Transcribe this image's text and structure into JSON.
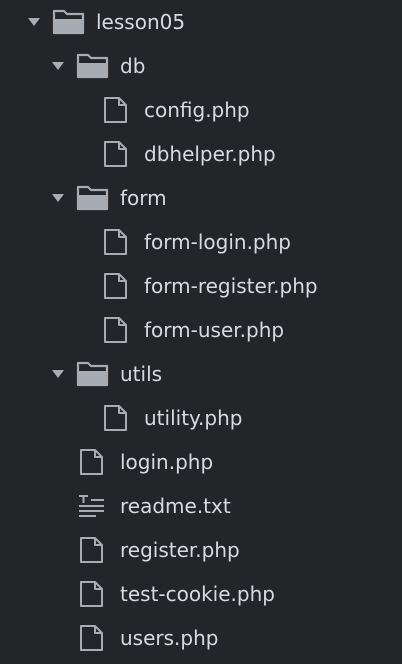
{
  "colors": {
    "background": "#232529",
    "text": "#d7dae0",
    "icon": "#a7abb2",
    "folder_fill": "#a7abb2"
  },
  "tree": {
    "root": {
      "label": "lesson05",
      "icon": "folder-open-icon",
      "expanded": true
    },
    "db": {
      "label": "db",
      "icon": "folder-open-icon",
      "expanded": true,
      "files": [
        {
          "label": "config.php",
          "icon": "file-icon"
        },
        {
          "label": "dbhelper.php",
          "icon": "file-icon"
        }
      ]
    },
    "form": {
      "label": "form",
      "icon": "folder-open-icon",
      "expanded": true,
      "files": [
        {
          "label": "form-login.php",
          "icon": "file-icon"
        },
        {
          "label": "form-register.php",
          "icon": "file-icon"
        },
        {
          "label": "form-user.php",
          "icon": "file-icon"
        }
      ]
    },
    "utils": {
      "label": "utils",
      "icon": "folder-open-icon",
      "expanded": true,
      "files": [
        {
          "label": "utility.php",
          "icon": "file-icon"
        }
      ]
    },
    "root_files": [
      {
        "label": "login.php",
        "icon": "file-icon"
      },
      {
        "label": "readme.txt",
        "icon": "text-file-icon"
      },
      {
        "label": "register.php",
        "icon": "file-icon"
      },
      {
        "label": "test-cookie.php",
        "icon": "file-icon"
      },
      {
        "label": "users.php",
        "icon": "file-icon"
      }
    ]
  }
}
